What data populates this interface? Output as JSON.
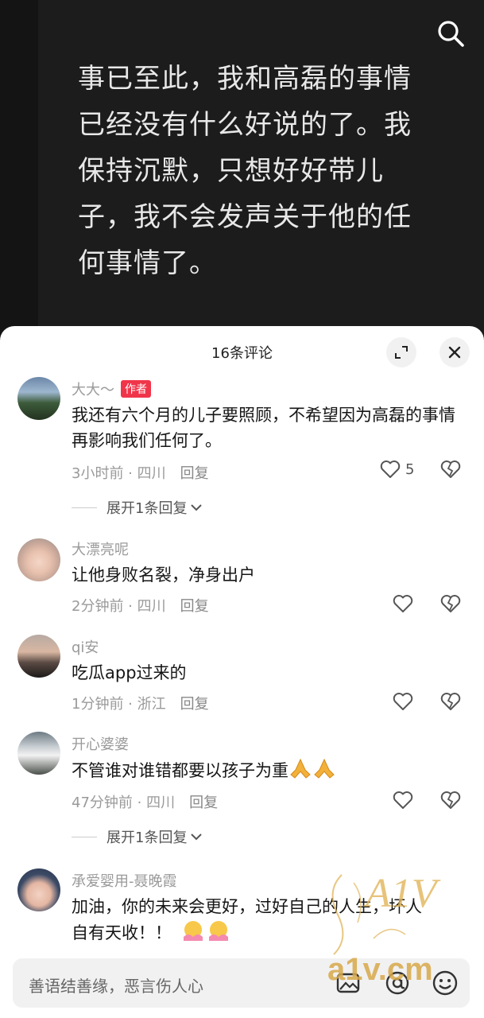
{
  "post": {
    "quote": "事已至此，我和高磊的事情已经没有什么好说的了。我保持沉默，只想好好带儿子，我不会发声关于他的任何事情了。"
  },
  "sheet": {
    "title": "16条评论"
  },
  "comments": [
    {
      "username": "大大～",
      "badge": "作者",
      "text": "我还有六个月的儿子要照顾，不希望因为高磊的事情再影响我们任何了。",
      "meta": "3小时前 · 四川",
      "reply": "回复",
      "likes": "5",
      "expand": "展开1条回复"
    },
    {
      "username": "大漂亮呢",
      "text": "让他身败名裂，净身出户",
      "meta": "2分钟前 · 四川",
      "reply": "回复"
    },
    {
      "username": "qi安",
      "text": "吃瓜app过来的",
      "meta": "1分钟前 · 浙江",
      "reply": "回复"
    },
    {
      "username": "开心婆婆",
      "text": "不管谁对谁错都要以孩子为重",
      "meta": "47分钟前 · 四川",
      "reply": "回复",
      "expand": "展开1条回复"
    },
    {
      "username": "承爱婴用-聂晚霞",
      "text_line1": "加油，你的未来会更好，过好自己的人生，坏人",
      "text_line2": "自有天收！！"
    }
  ],
  "input": {
    "placeholder": "善语结善缘，恶言伤人心"
  },
  "watermark": {
    "text": "a1v.cm",
    "logo": "A1V"
  },
  "colors": {
    "accent_red": "#f0354a",
    "sheet_bg": "#ffffff",
    "video_bg": "#1c1c1c"
  }
}
